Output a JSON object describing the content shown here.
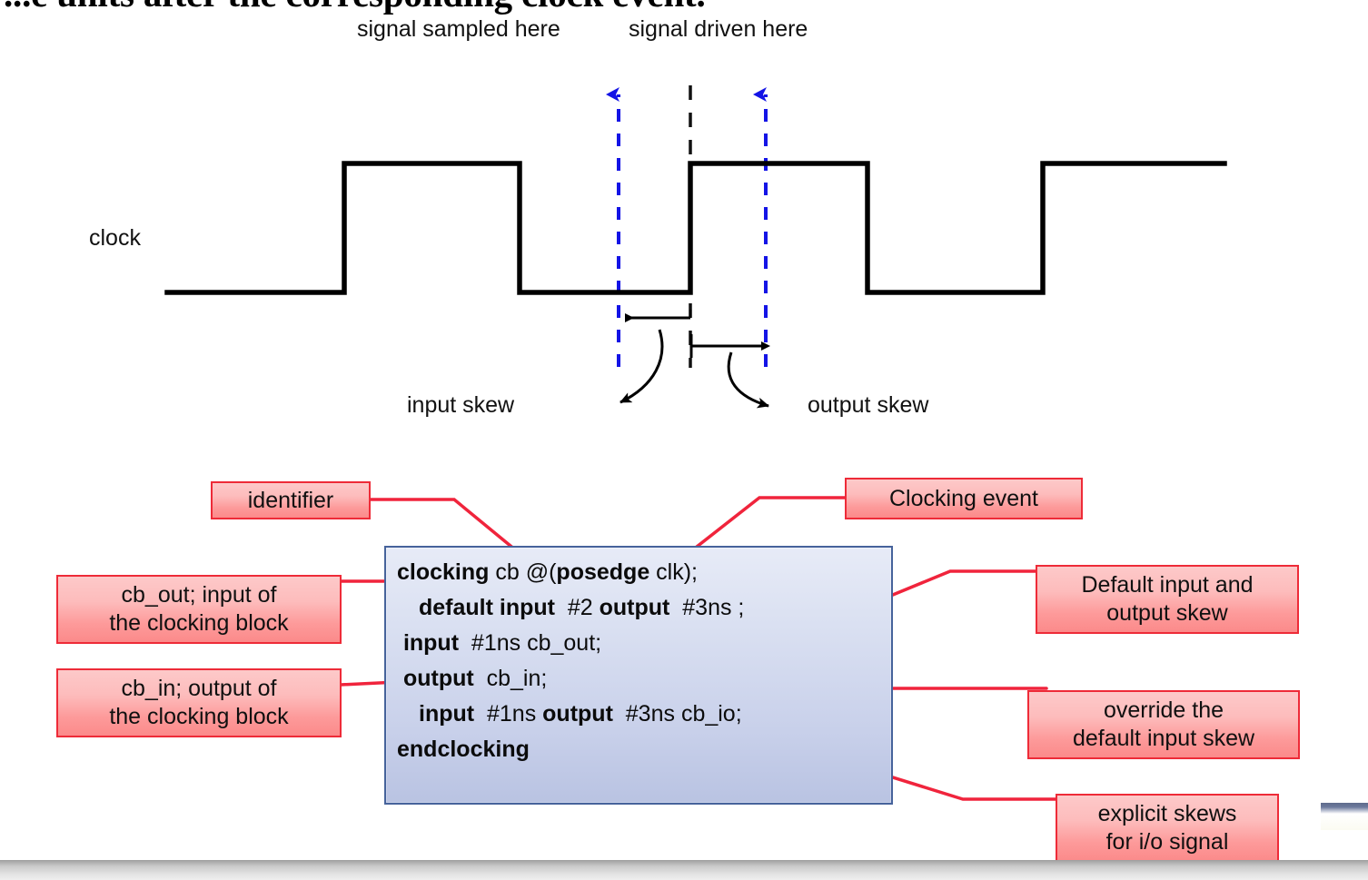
{
  "slide": {
    "title": "...e units after the corresponding clock event.",
    "bottom_strip_color": "#c9c9c9"
  },
  "waveform": {
    "signal_name": "clock",
    "top_labels": [
      {
        "name": "sampled",
        "text": "signal sampled here"
      },
      {
        "name": "driven",
        "text": "signal driven here"
      }
    ],
    "skew_labels": [
      {
        "name": "input-skew",
        "text": "input skew"
      },
      {
        "name": "output-skew",
        "text": "output skew"
      }
    ],
    "marker_color": "#1414e6",
    "clock_edge_color": "#000000"
  },
  "code": {
    "lines": [
      {
        "indent": 0,
        "tokens": [
          {
            "t": "clocking",
            "bold": true
          },
          {
            "t": " cb @(",
            "bold": false
          },
          {
            "t": "posedge",
            "bold": true
          },
          {
            "t": " clk);",
            "bold": false
          }
        ]
      },
      {
        "indent": 1,
        "tokens": [
          {
            "t": "default input",
            "bold": true
          },
          {
            "t": "  #2 ",
            "bold": false
          },
          {
            "t": "output",
            "bold": true
          },
          {
            "t": "  #3ns ;",
            "bold": false
          }
        ]
      },
      {
        "indent": 0,
        "tokens": [
          {
            "t": " input",
            "bold": true
          },
          {
            "t": "  #1ns cb_out;",
            "bold": false
          }
        ]
      },
      {
        "indent": 0,
        "tokens": [
          {
            "t": " output",
            "bold": true
          },
          {
            "t": "  cb_in;",
            "bold": false
          }
        ]
      },
      {
        "indent": 1,
        "tokens": [
          {
            "t": "input",
            "bold": true
          },
          {
            "t": "  #1ns ",
            "bold": false
          },
          {
            "t": "output",
            "bold": true
          },
          {
            "t": "  #3ns cb_io;",
            "bold": false
          }
        ]
      },
      {
        "indent": 0,
        "tokens": [
          {
            "t": "endclocking",
            "bold": true
          }
        ]
      }
    ],
    "border_color": "#46639b",
    "fill_color": "#c8d0ea"
  },
  "callouts": [
    {
      "name": "identifier",
      "text": "identifier"
    },
    {
      "name": "clocking-event",
      "text": "Clocking event"
    },
    {
      "name": "cb-out-input",
      "text": "cb_out; input of\nthe clocking block"
    },
    {
      "name": "cb-in-output",
      "text": "cb_in; output of\nthe clocking block"
    },
    {
      "name": "default-skew",
      "text": "Default input and\noutput skew"
    },
    {
      "name": "override-skew",
      "text": "override the\ndefault input skew"
    },
    {
      "name": "explicit-skews",
      "text": "explicit skews\nfor i/o signal"
    }
  ],
  "colors": {
    "callout_border": "#ee2b38",
    "callout_fill": "#fd9a9a",
    "leader_line": "#f0243c",
    "code_text": "#0b0b0b"
  }
}
